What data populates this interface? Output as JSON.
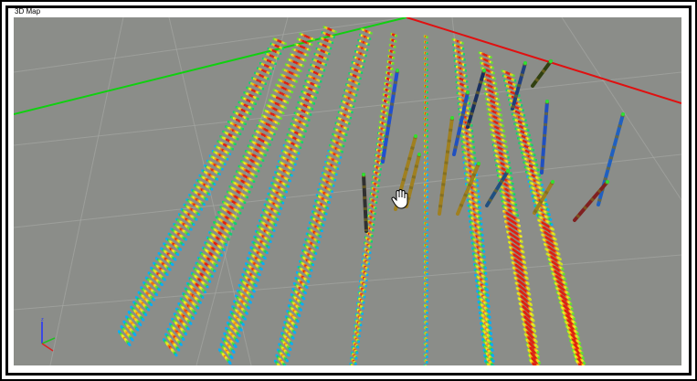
{
  "window": {
    "title": "3D Map"
  },
  "scene": {
    "background_color": "#8b8d89",
    "grid_color": "#a9aba7",
    "axis_x_color": "#e01010",
    "axis_y_color": "#10d010",
    "color_ramp": [
      "#00b0ff",
      "#10d070",
      "#60e030",
      "#c8e020",
      "#f0f020",
      "#f8c010",
      "#f07010",
      "#e02010"
    ]
  },
  "icons": {
    "cursor": "hand-cursor-icon",
    "orientation": "axis-triad-icon"
  }
}
